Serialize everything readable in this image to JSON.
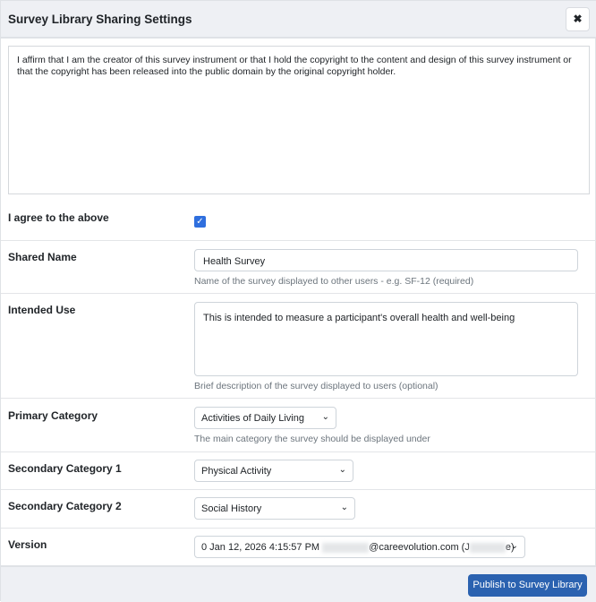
{
  "dialog": {
    "title": "Survey Library Sharing Settings",
    "close_icon": "close-icon"
  },
  "affirmation": "I affirm that I am the creator of this survey instrument or that I hold the copyright to the content and design of this survey instrument or that the copyright has been released into the public domain by the original copyright holder.",
  "agree": {
    "label": "I agree to the above",
    "checked": true
  },
  "shared_name": {
    "label": "Shared Name",
    "value": "Health Survey",
    "help": "Name of the survey displayed to other users - e.g. SF-12 (required)"
  },
  "intended_use": {
    "label": "Intended Use",
    "value": "This is intended to measure a participant's overall health and well-being",
    "help": "Brief description of the survey displayed to users (optional)"
  },
  "primary_category": {
    "label": "Primary Category",
    "value": "Activities of Daily Living",
    "help": "The main category the survey should be displayed under"
  },
  "secondary_category_1": {
    "label": "Secondary Category 1",
    "value": "Physical Activity"
  },
  "secondary_category_2": {
    "label": "Secondary Category 2",
    "value": "Social History"
  },
  "version": {
    "label": "Version",
    "value_prefix": "0 Jan 12, 2026 4:15:57 PM",
    "value_email_domain": "@careevolution.com (J",
    "value_suffix": "e)"
  },
  "footer": {
    "publish_label": "Publish to Survey Library"
  },
  "colors": {
    "accent": "#2b62b0",
    "checkbox": "#2f6fde"
  }
}
